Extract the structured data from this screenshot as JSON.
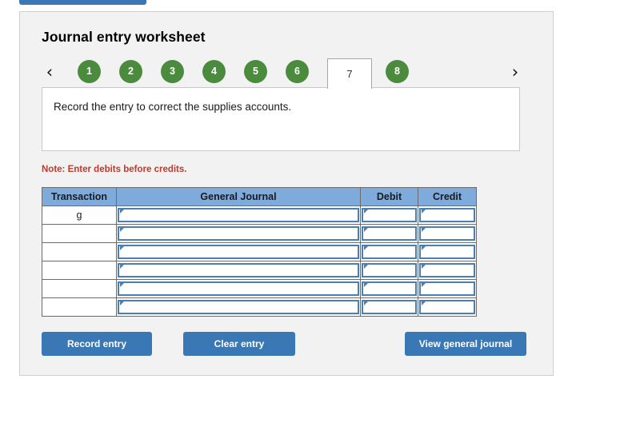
{
  "colors": {
    "tab_green": "#4a8b3e",
    "button_blue": "#3a78b5",
    "header_blue": "#7eabdc",
    "note_red": "#c0392b",
    "panel_bg": "#f2f2f2",
    "field_border": "#4a7fb5"
  },
  "panel": {
    "title": "Journal entry worksheet"
  },
  "tabs": {
    "prev_icon": "chevron-left-icon",
    "next_icon": "chevron-right-icon",
    "prev_glyph": "‹",
    "next_glyph": "›",
    "items": [
      {
        "label": "1",
        "active": false
      },
      {
        "label": "2",
        "active": false
      },
      {
        "label": "3",
        "active": false
      },
      {
        "label": "4",
        "active": false
      },
      {
        "label": "5",
        "active": false
      },
      {
        "label": "6",
        "active": false
      },
      {
        "label": "7",
        "active": true
      },
      {
        "label": "8",
        "active": false
      }
    ]
  },
  "instruction": {
    "text": "Record the entry to correct the supplies accounts."
  },
  "note": {
    "text": "Note: Enter debits before credits."
  },
  "table": {
    "headers": [
      "Transaction",
      "General Journal",
      "Debit",
      "Credit"
    ],
    "rows": [
      {
        "transaction": "g",
        "general_journal": "",
        "debit": "",
        "credit": ""
      },
      {
        "transaction": "",
        "general_journal": "",
        "debit": "",
        "credit": ""
      },
      {
        "transaction": "",
        "general_journal": "",
        "debit": "",
        "credit": ""
      },
      {
        "transaction": "",
        "general_journal": "",
        "debit": "",
        "credit": ""
      },
      {
        "transaction": "",
        "general_journal": "",
        "debit": "",
        "credit": ""
      },
      {
        "transaction": "",
        "general_journal": "",
        "debit": "",
        "credit": ""
      }
    ]
  },
  "buttons": {
    "record": "Record entry",
    "clear": "Clear entry",
    "view": "View general journal"
  }
}
